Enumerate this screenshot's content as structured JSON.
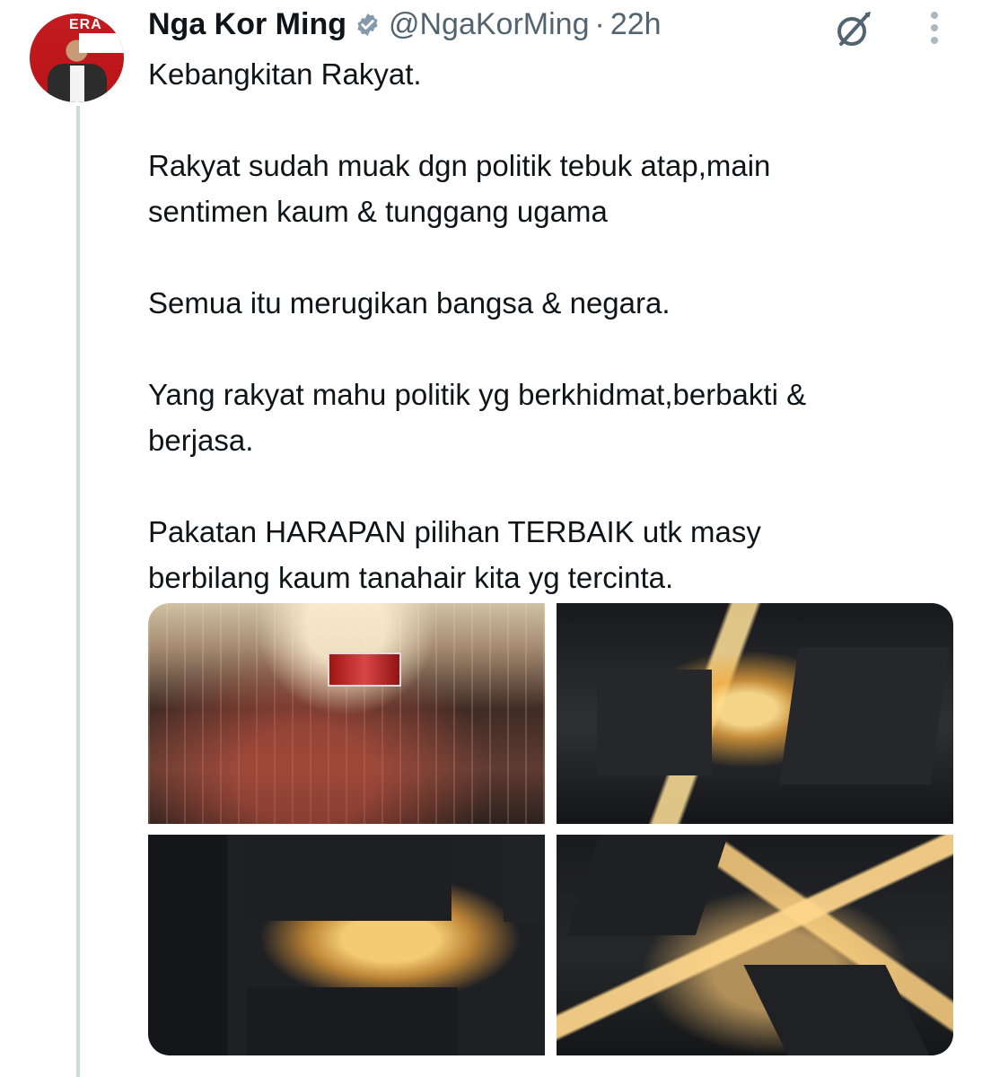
{
  "post": {
    "author_name": "Nga Kor Ming",
    "handle": "@NgaKorMing",
    "separator": "·",
    "time": "22h",
    "text": {
      "lines": [
        "Kebangkitan Rakyat.",
        "",
        "Rakyat sudah muak dgn politik tebuk atap,main",
        "sentimen kaum & tunggang ugama",
        "",
        "Semua itu merugikan bangsa & negara.",
        "",
        "Yang rakyat mahu politik yg berkhidmat,berbakti &",
        "berjasa.",
        "",
        "Pakatan HARAPAN pilihan TERBAIK utk masy",
        "berbilang kaum tanahair kita yg tercinta."
      ]
    }
  },
  "avatar": {
    "banner_text": "ERA"
  },
  "icons": {
    "verified": "verified-badge-icon",
    "grok": "grok-icon",
    "more": "more-options-icon"
  },
  "colors": {
    "text": "#0f1419",
    "secondary": "#536471",
    "thread_line": "#cfd9de",
    "verified_gold": "#829aab"
  }
}
